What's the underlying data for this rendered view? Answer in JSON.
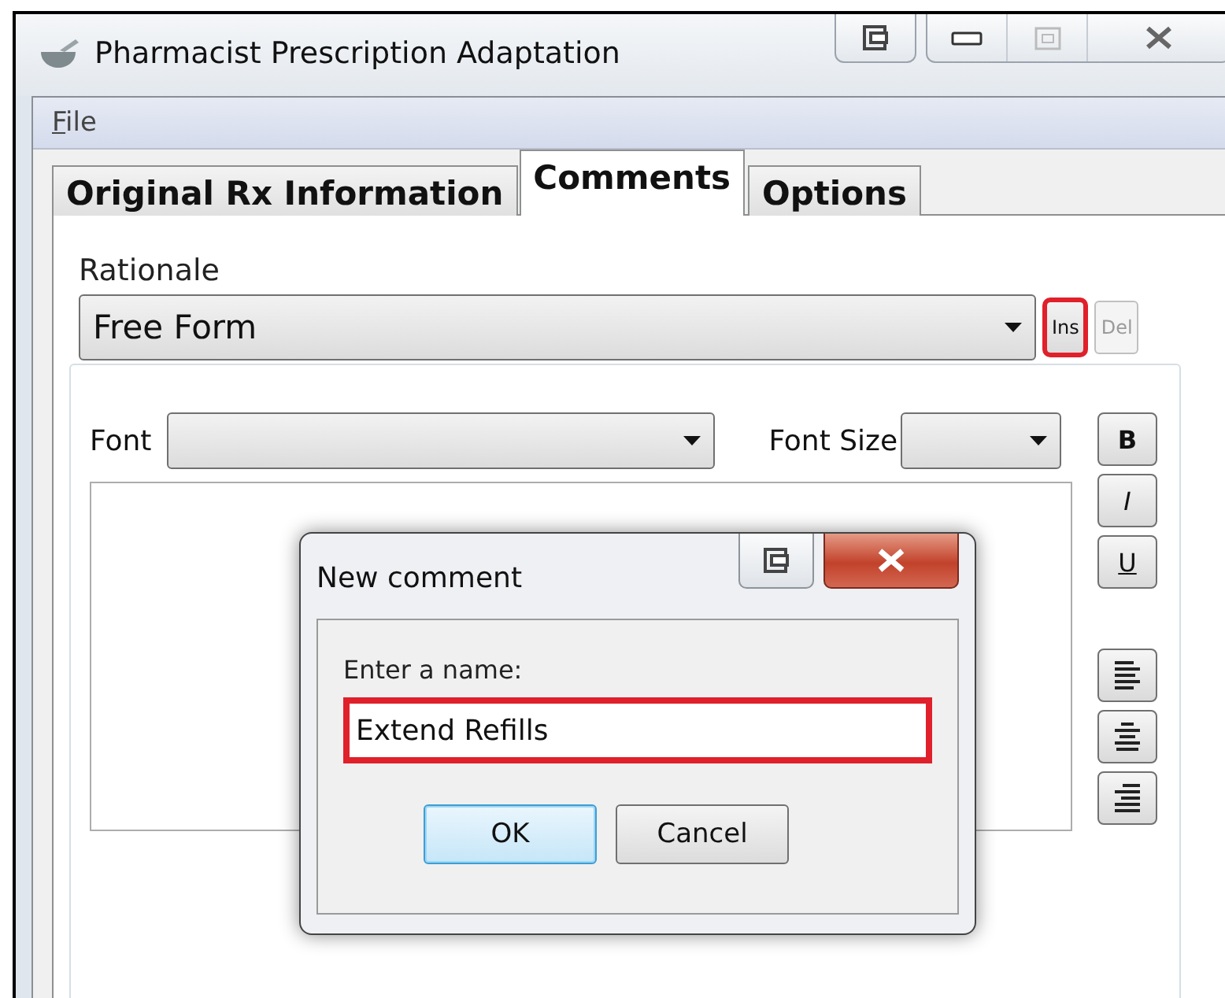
{
  "window": {
    "title": "Pharmacist Prescription Adaptation"
  },
  "menu": [
    {
      "label": "File"
    }
  ],
  "tabs": [
    {
      "label": "Original Rx Information",
      "selected": false
    },
    {
      "label": "Comments",
      "selected": true
    },
    {
      "label": "Options",
      "selected": false
    }
  ],
  "rationale": {
    "label": "Rationale",
    "value": "Free Form",
    "buttons": [
      {
        "label": "Ins",
        "disabled": false,
        "highlighted": true
      },
      {
        "label": "Del",
        "disabled": true,
        "highlighted": false
      }
    ]
  },
  "editor": {
    "font_label": "Font",
    "font_size_label": "Font Size",
    "format_buttons": [
      {
        "label": "B",
        "kind": "bold"
      },
      {
        "label": "I",
        "kind": "italic"
      },
      {
        "label": "U",
        "kind": "underline"
      }
    ],
    "align_buttons": [
      {
        "kind": "left"
      },
      {
        "kind": "center"
      },
      {
        "kind": "right"
      }
    ]
  },
  "dialog": {
    "title": "New comment",
    "prompt": "Enter a name:",
    "value": "Extend Refills",
    "highlighted": true,
    "buttons": [
      {
        "label": "OK",
        "default": true
      },
      {
        "label": "Cancel",
        "default": false
      }
    ]
  }
}
